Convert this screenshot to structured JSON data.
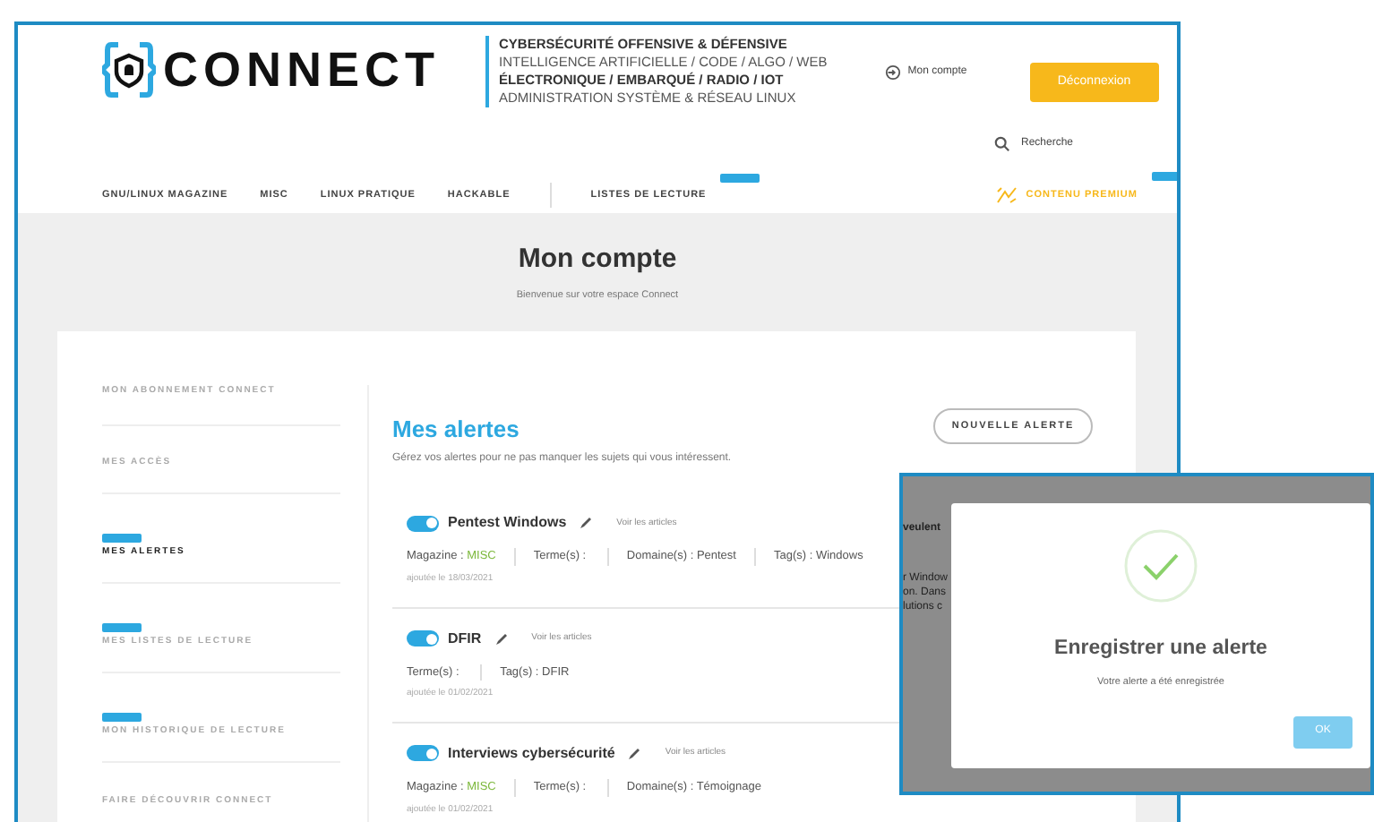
{
  "header": {
    "logo": "CONNECT",
    "taglines": [
      {
        "text": "CYBERSÉCURITÉ OFFENSIVE & DÉFENSIVE",
        "bold": true
      },
      {
        "text": "INTELLIGENCE ARTIFICIELLE / CODE / ALGO / WEB",
        "bold": false
      },
      {
        "text": "ÉLECTRONIQUE / EMBARQUÉ / RADIO / IOT",
        "bold": true
      },
      {
        "text": "ADMINISTRATION SYSTÈME & RÉSEAU LINUX",
        "bold": false
      }
    ],
    "account_link": "Mon compte",
    "logout_button": "Déconnexion",
    "search": "Recherche"
  },
  "nav": [
    {
      "label": "GNU/LINUX MAGAZINE",
      "badge": false,
      "kind": "link"
    },
    {
      "label": "MISC",
      "badge": false,
      "kind": "link"
    },
    {
      "label": "LINUX PRATIQUE",
      "badge": false,
      "kind": "link"
    },
    {
      "label": "HACKABLE",
      "badge": false,
      "kind": "link"
    },
    {
      "label": "LISTES DE LECTURE",
      "badge": true,
      "kind": "link"
    },
    {
      "label": "CONTENU PREMIUM",
      "badge": true,
      "kind": "premium"
    }
  ],
  "page": {
    "title": "Mon compte",
    "subtitle": "Bienvenue sur votre espace Connect"
  },
  "sidebar": {
    "items": [
      {
        "label": "MON ABONNEMENT CONNECT",
        "selected": false,
        "badge": false
      },
      {
        "label": "MES ACCÈS",
        "selected": false,
        "badge": false
      },
      {
        "label": "MES ALERTES",
        "selected": true,
        "badge": true
      },
      {
        "label": "MES LISTES DE LECTURE",
        "selected": false,
        "badge": true
      },
      {
        "label": "MON HISTORIQUE DE LECTURE",
        "selected": false,
        "badge": true
      },
      {
        "label": "FAIRE DÉCOUVRIR CONNECT",
        "selected": false,
        "badge": false
      }
    ]
  },
  "alerts": {
    "title": "Mes alertes",
    "description": "Gérez vos alertes pour ne pas manquer les sujets qui vous intéressent.",
    "new_button": "NOUVELLE ALERTE",
    "items": [
      {
        "name": "Pentest Windows",
        "on": true,
        "link": "Voir les articles",
        "fields": [
          {
            "kind": "magazine",
            "label": "Magazine :",
            "value": "MISC"
          },
          {
            "kind": "plain",
            "label": "Terme(s) :"
          },
          {
            "kind": "plain",
            "label": "Domaine(s) :",
            "value": "Pentest"
          },
          {
            "kind": "plain",
            "label": "Tag(s) :",
            "value": "Windows"
          }
        ],
        "date": "ajoutée le 18/03/2021"
      },
      {
        "name": "DFIR",
        "on": true,
        "link": "Voir les articles",
        "fields": [
          {
            "kind": "plain",
            "label": "Terme(s) :"
          },
          {
            "kind": "plain",
            "label": "Tag(s) :",
            "value": "DFIR"
          }
        ],
        "date": "ajoutée le 01/02/2021"
      },
      {
        "name": "Interviews cybersécurité",
        "on": true,
        "link": "Voir les articles",
        "fields": [
          {
            "kind": "magazine",
            "label": "Magazine :",
            "value": "MISC"
          },
          {
            "kind": "plain",
            "label": "Terme(s) :"
          },
          {
            "kind": "plain",
            "label": "Domaine(s) :",
            "value": "Témoignage"
          }
        ],
        "date": "ajoutée le 01/02/2021"
      }
    ]
  },
  "dialog": {
    "background_fragments": [
      "veulent",
      "r Window",
      "on. Dans",
      "lutions c"
    ],
    "title": "Enregistrer une alerte",
    "message": "Votre alerte a été enregistrée",
    "ok_button": "OK"
  }
}
